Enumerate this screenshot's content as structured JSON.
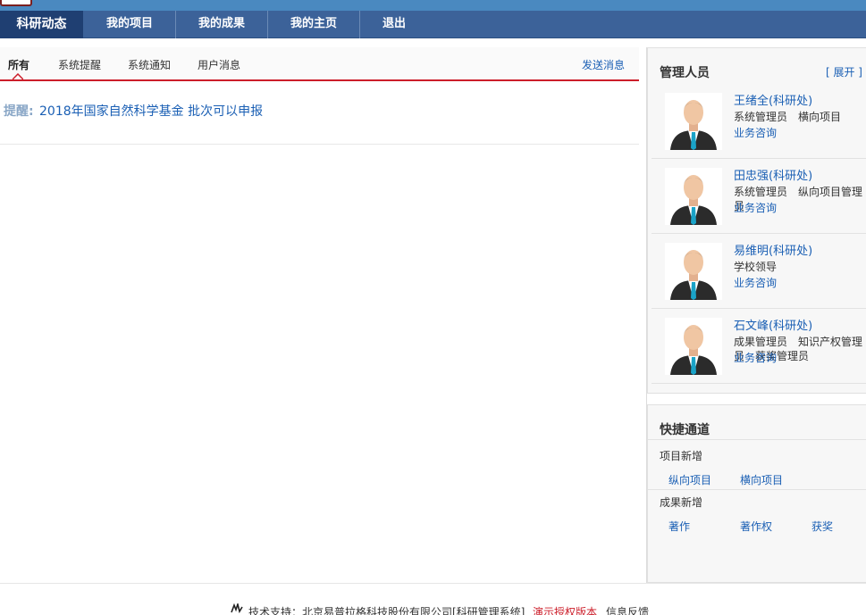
{
  "nav": {
    "items": [
      {
        "label": "科研动态",
        "active": true
      },
      {
        "label": "我的项目",
        "active": false
      },
      {
        "label": "我的成果",
        "active": false
      },
      {
        "label": "我的主页",
        "active": false
      },
      {
        "label": "退出",
        "active": false
      }
    ]
  },
  "tabs": {
    "items": [
      {
        "label": "所有",
        "active": true
      },
      {
        "label": "系统提醒",
        "active": false
      },
      {
        "label": "系统通知",
        "active": false
      },
      {
        "label": "用户消息",
        "active": false
      }
    ],
    "send_label": "发送消息"
  },
  "messages": [
    {
      "label": "提醒:",
      "text": "2018年国家自然科学基金 批次可以申报"
    }
  ],
  "admins_panel": {
    "title": "管理人员",
    "toggle_label": "[ 展开 ]",
    "admins": [
      {
        "name": "王绪全(科研处)",
        "role": "系统管理员　横向项目",
        "consult": "业务咨询"
      },
      {
        "name": "田忠强(科研处)",
        "role": "系统管理员　纵向项目管理员",
        "consult": "业务咨询"
      },
      {
        "name": "易维明(科研处)",
        "role": "学校领导",
        "consult": "业务咨询"
      },
      {
        "name": "石文峰(科研处)",
        "role": "成果管理员　知识产权管理员　获奖管理员",
        "consult": "业务咨询"
      }
    ]
  },
  "quick_panel": {
    "title": "快捷通道",
    "groups": [
      {
        "label": "项目新增",
        "links": [
          "纵向项目",
          "横向项目"
        ]
      },
      {
        "label": "成果新增",
        "links": [
          "著作",
          "著作权",
          "获奖"
        ]
      }
    ]
  },
  "footer": {
    "support_text": "技术支持：北京易普拉格科技股份有限公司[科研管理系统]",
    "demo_label": "演示授权版本",
    "feedback_label": "信息反馈"
  },
  "colors": {
    "nav_bg": "#3c6299",
    "nav_active": "#1f3f72",
    "accent_red": "#cc1e2a",
    "link_blue": "#1a5fb4"
  }
}
